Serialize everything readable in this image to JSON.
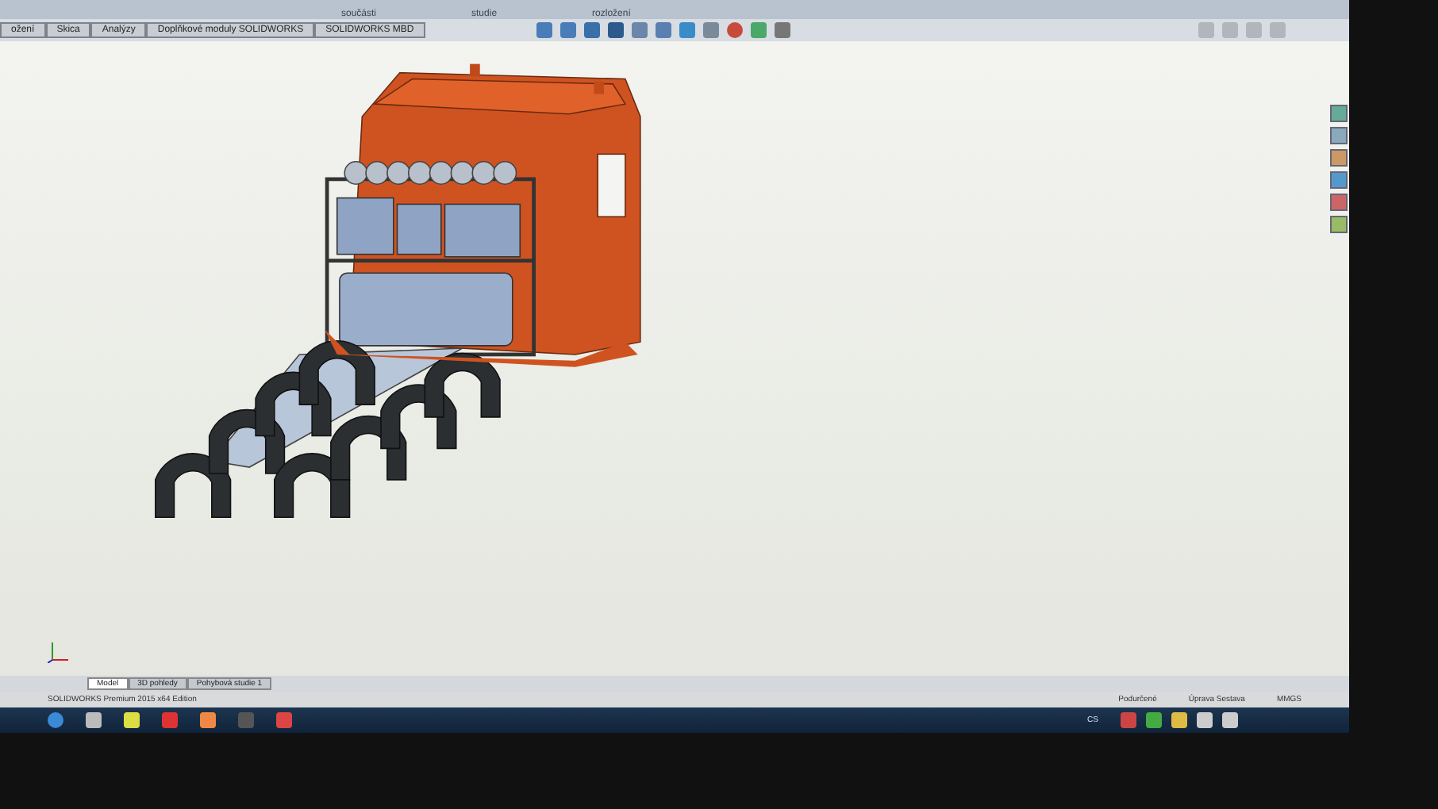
{
  "ribbon": {
    "labels": [
      "součásti",
      "studie",
      "rozložení"
    ]
  },
  "command_tabs": [
    {
      "label": "ožení",
      "selected": false
    },
    {
      "label": "Skica",
      "selected": false
    },
    {
      "label": "Analýzy",
      "selected": false
    },
    {
      "label": "Doplňkové moduly SOLIDWORKS",
      "selected": false
    },
    {
      "label": "SOLIDWORKS MBD",
      "selected": false
    }
  ],
  "bottom_tabs": [
    {
      "label": "Model",
      "selected": true
    },
    {
      "label": "3D pohledy",
      "selected": false
    },
    {
      "label": "Pohybová studie 1",
      "selected": false
    }
  ],
  "status_bar": {
    "product": "SOLIDWORKS Premium 2015 x64 Edition",
    "state": "Podurčené",
    "mode": "Úprava Sestava",
    "units": "MMGS"
  },
  "taskbar": {
    "language": "CS"
  }
}
